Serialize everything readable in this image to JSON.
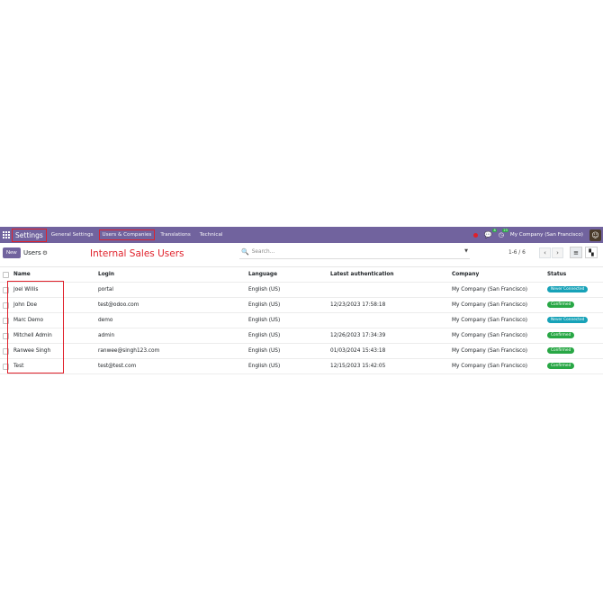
{
  "navbar": {
    "app_name": "Settings",
    "menu": [
      "General Settings",
      "Users & Companies",
      "Translations",
      "Technical"
    ],
    "company": "My Company (San Francisco)",
    "chat_badge": "8",
    "activity_badge": "23",
    "icons": {
      "apps": "grid-icon",
      "chat": "chat-icon",
      "activity": "clock-icon",
      "avatar": "user-avatar"
    }
  },
  "control": {
    "new_label": "New",
    "breadcrumb": "Users",
    "annotation": "Internal Sales Users",
    "search_placeholder": "Search...",
    "pager": "1-6 / 6"
  },
  "table": {
    "headers": [
      "Name",
      "Login",
      "Language",
      "Latest authentication",
      "Company",
      "Status"
    ],
    "rows": [
      {
        "name": "Joel Willis",
        "login": "portal",
        "language": "English (US)",
        "auth": "",
        "company": "My Company (San Francisco)",
        "status": "Never Connected"
      },
      {
        "name": "John Doe",
        "login": "test@odoo.com",
        "language": "English (US)",
        "auth": "12/23/2023 17:58:18",
        "company": "My Company (San Francisco)",
        "status": "Confirmed"
      },
      {
        "name": "Marc Demo",
        "login": "demo",
        "language": "English (US)",
        "auth": "",
        "company": "My Company (San Francisco)",
        "status": "Never Connected"
      },
      {
        "name": "Mitchell Admin",
        "login": "admin",
        "language": "English (US)",
        "auth": "12/26/2023 17:34:39",
        "company": "My Company (San Francisco)",
        "status": "Confirmed"
      },
      {
        "name": "Ranwee Singh",
        "login": "ranwee@singh123.com",
        "language": "English (US)",
        "auth": "01/03/2024 15:43:18",
        "company": "My Company (San Francisco)",
        "status": "Confirmed"
      },
      {
        "name": "Test",
        "login": "test@test.com",
        "language": "English (US)",
        "auth": "12/15/2023 15:42:05",
        "company": "My Company (San Francisco)",
        "status": "Confirmed"
      }
    ]
  },
  "colors": {
    "brand": "#71639e",
    "confirmed": "#28a745",
    "never_connected": "#17a2b8",
    "annotation": "#e0202a"
  }
}
